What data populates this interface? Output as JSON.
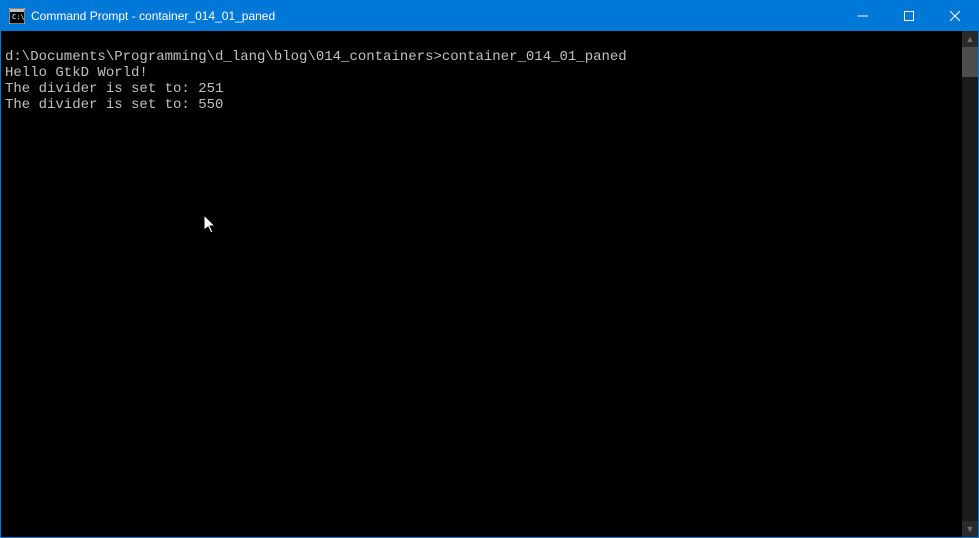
{
  "window": {
    "title": "Command Prompt - container_014_01_paned"
  },
  "terminal": {
    "prompt_path": "d:\\Documents\\Programming\\d_lang\\blog\\014_containers>",
    "command": "container_014_01_paned",
    "lines": [
      "Hello GtkD World!",
      "The divider is set to: 251",
      "The divider is set to: 550"
    ]
  },
  "icons": {
    "app": "cmd-icon",
    "minimize": "minimize-icon",
    "maximize": "maximize-icon",
    "close": "close-icon",
    "scroll_up": "chevron-up-icon",
    "scroll_down": "chevron-down-icon"
  }
}
